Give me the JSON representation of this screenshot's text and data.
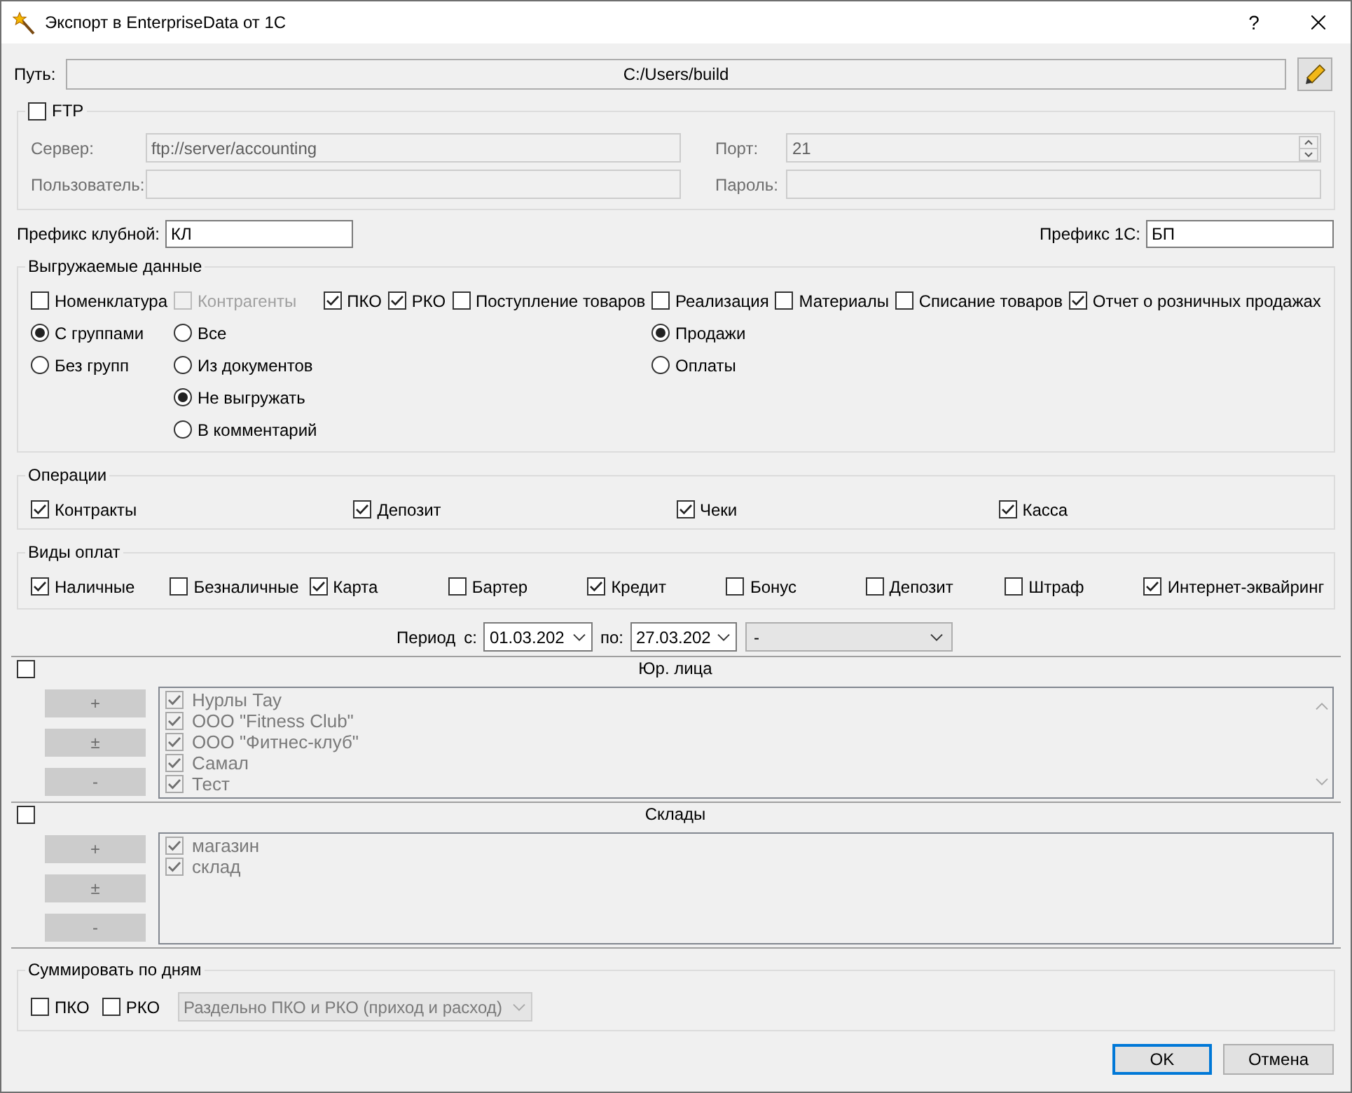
{
  "window": {
    "title": "Экспорт в EnterpriseData от 1С",
    "help": "?"
  },
  "path": {
    "label": "Путь:",
    "value": "C:/Users/build"
  },
  "ftp": {
    "label": "FTP",
    "checked": false,
    "fields": [
      {
        "kind": "text",
        "label": "Сервер:",
        "value": "ftp://server/accounting"
      },
      {
        "kind": "spin",
        "label": "Порт:",
        "value": "21"
      },
      {
        "kind": "text",
        "label": "Пользователь:"
      },
      {
        "kind": "text",
        "label": "Пароль:"
      }
    ]
  },
  "prefixes": [
    {
      "label": "Префикс клубной:",
      "value": "КЛ"
    },
    {
      "label": "Префикс 1С:",
      "value": "БП"
    }
  ],
  "exported_data": {
    "title": "Выгружаемые данные",
    "items": [
      {
        "label": "Номенклатура",
        "checked": false,
        "disabled": false,
        "options": [
          {
            "label": "С группами",
            "selected": true
          },
          {
            "label": "Без групп",
            "selected": false
          }
        ]
      },
      {
        "label": "Контрагенты",
        "checked": false,
        "disabled": true,
        "options": [
          {
            "label": "Все",
            "selected": false
          },
          {
            "label": "Из документов",
            "selected": false
          },
          {
            "label": "Не выгружать",
            "selected": true
          },
          {
            "label": "В комментарий",
            "selected": false
          }
        ]
      },
      {
        "label": "ПКО",
        "checked": true,
        "disabled": false
      },
      {
        "label": "РКО",
        "checked": true,
        "disabled": false
      },
      {
        "label": "Поступление товаров",
        "checked": false,
        "disabled": false
      },
      {
        "label": "Реализация",
        "checked": false,
        "disabled": false,
        "options": [
          {
            "label": "Продажи",
            "selected": true
          },
          {
            "label": "Оплаты",
            "selected": false
          }
        ]
      },
      {
        "label": "Материалы",
        "checked": false,
        "disabled": false
      },
      {
        "label": "Списание товаров",
        "checked": false,
        "disabled": false
      },
      {
        "label": "Отчет о розничных продажах",
        "checked": true,
        "disabled": false
      }
    ]
  },
  "operations": {
    "title": "Операции",
    "items": [
      {
        "label": "Контракты",
        "checked": true
      },
      {
        "label": "Депозит",
        "checked": true
      },
      {
        "label": "Чеки",
        "checked": true
      },
      {
        "label": "Касса",
        "checked": true
      }
    ]
  },
  "payment_types": {
    "title": "Виды оплат",
    "items": [
      {
        "label": "Наличные",
        "checked": true
      },
      {
        "label": "Безналичные",
        "checked": false
      },
      {
        "label": "Карта",
        "checked": true
      },
      {
        "label": "Бартер",
        "checked": false
      },
      {
        "label": "Кредит",
        "checked": true
      },
      {
        "label": "Бонус",
        "checked": false
      },
      {
        "label": "Депозит",
        "checked": false
      },
      {
        "label": "Штраф",
        "checked": false
      },
      {
        "label": "Интернет-эквайринг",
        "checked": true
      }
    ]
  },
  "period": {
    "label": "Период",
    "from_label": "с:",
    "from": "01.03.202",
    "to_label": "по:",
    "to": "27.03.202",
    "filter": "-"
  },
  "legal_entities": {
    "title": "Юр. лица",
    "checked": false,
    "disabled": true,
    "buttons": [
      "+",
      "±",
      "-"
    ],
    "items": [
      {
        "label": "Нурлы Тау",
        "checked": true
      },
      {
        "label": "ООО \"Fitness Club\"",
        "checked": true
      },
      {
        "label": "ООО \"Фитнес-клуб\"",
        "checked": true
      },
      {
        "label": "Самал",
        "checked": true
      },
      {
        "label": "Тест",
        "checked": true
      }
    ]
  },
  "warehouses": {
    "title": "Склады",
    "checked": false,
    "disabled": true,
    "buttons": [
      "+",
      "±",
      "-"
    ],
    "items": [
      {
        "label": "магазин",
        "checked": true
      },
      {
        "label": "склад",
        "checked": true
      }
    ]
  },
  "daily_summary": {
    "title": "Суммировать по дням",
    "items": [
      {
        "label": "ПКО",
        "checked": false
      },
      {
        "label": "РКО",
        "checked": false
      }
    ],
    "mode": {
      "value": "Раздельно ПКО и РКО (приход и расход)",
      "disabled": true
    }
  },
  "buttons": [
    {
      "label": "OK",
      "default": true
    },
    {
      "label": "Отмена",
      "default": false
    }
  ]
}
